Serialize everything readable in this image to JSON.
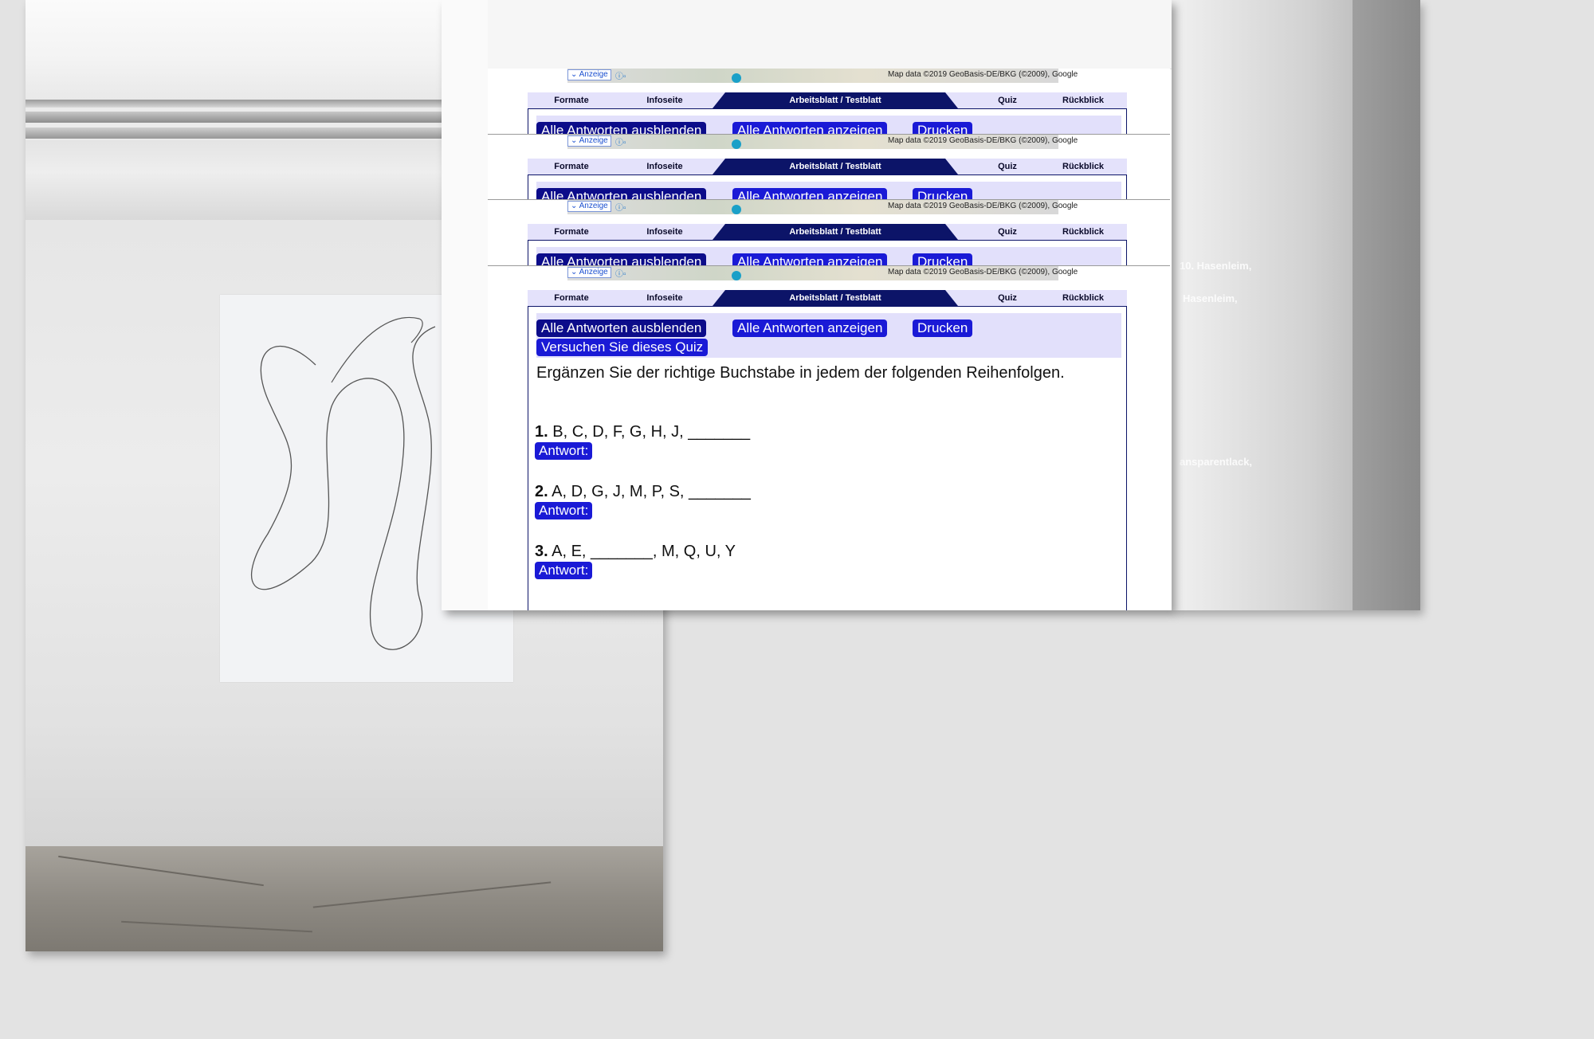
{
  "side_text": [
    "10. Hasenleim,",
    "Hasenleim,",
    "ansparentlack,"
  ],
  "map": {
    "anzeige": "Anzeige",
    "credit": "Map data ©2019 GeoBasis-DE/BKG (©2009), Google"
  },
  "tabs": [
    {
      "label": "Formate"
    },
    {
      "label": "Infoseite"
    },
    {
      "label": "Arbeitsblatt / Testblatt"
    },
    {
      "label": "Quiz"
    },
    {
      "label": "Rückblick"
    }
  ],
  "buttons": {
    "hide_all": "Alle Antworten ausblenden",
    "show_all": "Alle Antworten anzeigen",
    "print": "Drucken",
    "try_quiz": "Versuchen Sie dieses Quiz"
  },
  "instruction": "Ergänzen Sie der richtige Buchstabe in jedem der folgenden Reihenfolgen.",
  "questions": [
    {
      "num": "1.",
      "text": "B, C, D, F, G, H, J, _______",
      "answer_label": "Antwort:"
    },
    {
      "num": "2.",
      "text": "A, D, G, J, M, P, S, _______",
      "answer_label": "Antwort:"
    },
    {
      "num": "3.",
      "text": "A, E, _______, M, Q, U, Y",
      "answer_label": "Antwort:"
    }
  ],
  "colors": {
    "accent": "#1a1ad6",
    "tab_active": "#0c1468",
    "tabbar": "#e4e2fb"
  }
}
